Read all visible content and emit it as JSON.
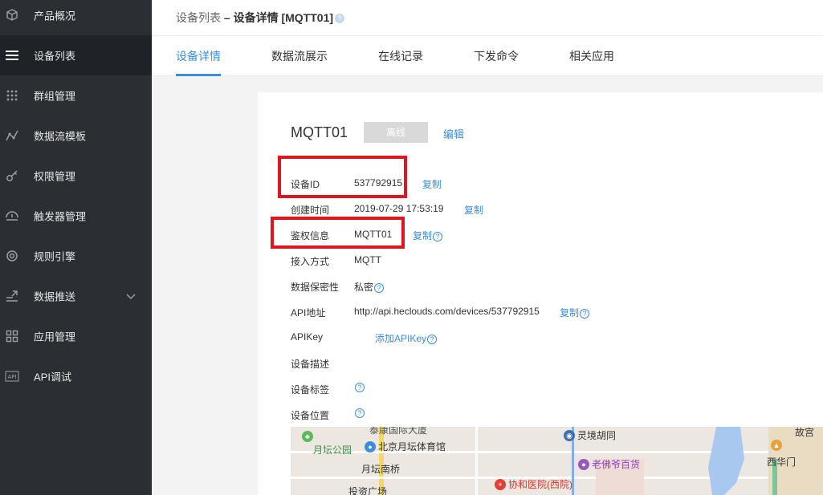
{
  "sidebar": {
    "items": [
      {
        "label": "产品概况",
        "icon": "cube-icon"
      },
      {
        "label": "设备列表",
        "icon": "menu-icon"
      },
      {
        "label": "群组管理",
        "icon": "grid-dots-icon"
      },
      {
        "label": "数据流模板",
        "icon": "line-chart-icon"
      },
      {
        "label": "权限管理",
        "icon": "key-icon"
      },
      {
        "label": "触发器管理",
        "icon": "trigger-icon"
      },
      {
        "label": "规则引擎",
        "icon": "rule-engine-icon"
      },
      {
        "label": "数据推送",
        "icon": "push-icon"
      },
      {
        "label": "应用管理",
        "icon": "apps-grid-icon"
      },
      {
        "label": "API调试",
        "icon": "api-icon"
      }
    ]
  },
  "header": {
    "breadcrumb_parent": "设备列表",
    "breadcrumb_sep": " – ",
    "breadcrumb_current": "设备详情 [MQTT01]",
    "help_glyph": "?"
  },
  "tabs": [
    {
      "label": "设备详情"
    },
    {
      "label": "数据流展示"
    },
    {
      "label": "在线记录"
    },
    {
      "label": "下发命令"
    },
    {
      "label": "相关应用"
    }
  ],
  "device": {
    "name": "MQTT01",
    "status": "离线",
    "edit_label": "编辑",
    "copy_label": "复制",
    "help_glyph": "?",
    "fields": {
      "id_label": "设备ID",
      "id_value": "537792915",
      "created_label": "创建时间",
      "created_value": "2019-07-29 17:53:19",
      "auth_label": "鉴权信息",
      "auth_value": "MQTT01",
      "access_label": "接入方式",
      "access_value": "MQTT",
      "privacy_label": "数据保密性",
      "privacy_value": "私密",
      "api_label": "API地址",
      "api_value": "http://api.heclouds.com/devices/537792915",
      "apikey_label": "APIKey",
      "apikey_action": "添加APIKey",
      "desc_label": "设备描述",
      "tags_label": "设备标签",
      "location_label": "设备位置"
    }
  },
  "map": {
    "labels": {
      "a": "泰康国际大厦",
      "b": "月坛公园",
      "c": "北京月坛体育馆",
      "d": "月坛南桥",
      "e": "投资广场",
      "f": "灵境胡同",
      "g": "老佛爷百货",
      "h": "协和医院(西院)",
      "i": "西华门",
      "j": "故宫"
    }
  },
  "colors": {
    "accent": "#3c8dde",
    "sidebar_bg": "#2b2f33",
    "highlight_box": "#e0161f"
  }
}
